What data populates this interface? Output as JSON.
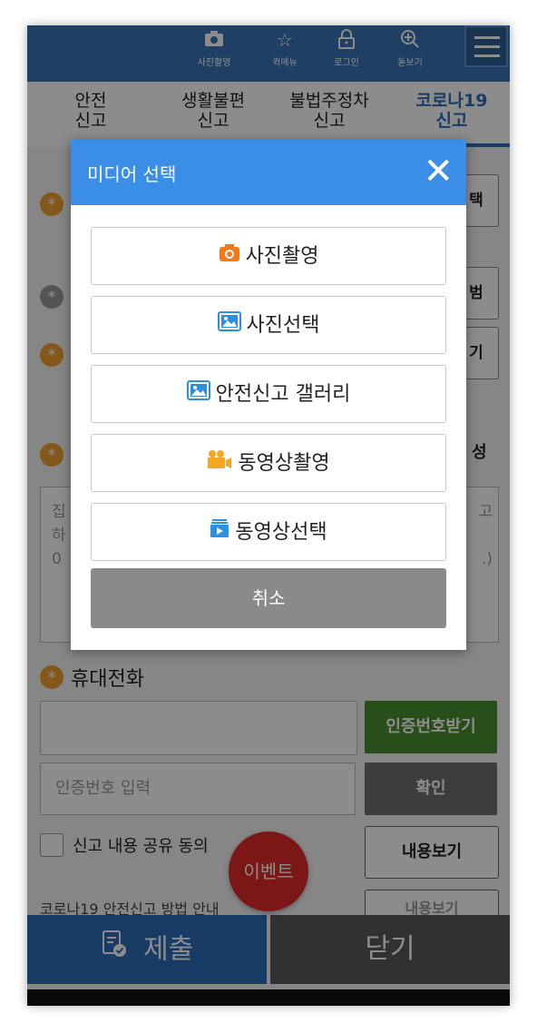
{
  "topbar": {
    "items": [
      {
        "label": "사진촬영",
        "icon": "camera-icon"
      },
      {
        "label": "퀵메뉴",
        "icon": "star-icon"
      },
      {
        "label": "로그인",
        "icon": "lock-icon"
      },
      {
        "label": "돋보기",
        "icon": "zoom-icon"
      }
    ],
    "menu_icon": "hamburger-icon"
  },
  "tabs": [
    {
      "line1": "안전",
      "line2": "신고"
    },
    {
      "line1": "생활불편",
      "line2": "신고"
    },
    {
      "line1": "불법주정차",
      "line2": "신고"
    },
    {
      "line1": "코로나19",
      "line2": "신고"
    }
  ],
  "form": {
    "side_buttons": [
      "택",
      "범",
      "기"
    ],
    "label_suffix": "성",
    "textbox_lines": [
      "집",
      "하",
      "0"
    ],
    "textbox_right": [
      "고",
      ".)"
    ],
    "phone_label": "휴대전화",
    "auth_input_placeholder": "인증번호 입력",
    "request_auth_button": "인증번호받기",
    "confirm_button": "확인",
    "share_consent": "신고 내용 공유 동의",
    "view_content_button": "내용보기",
    "cut_text": "코로나19 안전신고 방법 안내",
    "cut_button": "내용보기"
  },
  "event_button": "이벤트",
  "bottom": {
    "submit": "제출",
    "close": "닫기"
  },
  "modal": {
    "title": "미디어 선택",
    "options": [
      {
        "label": "사진촬영",
        "icon": "camera-icon"
      },
      {
        "label": "사진선택",
        "icon": "image-icon"
      },
      {
        "label": "안전신고 갤러리",
        "icon": "image-icon"
      },
      {
        "label": "동영상촬영",
        "icon": "video-camera-icon"
      },
      {
        "label": "동영상선택",
        "icon": "video-file-icon"
      }
    ],
    "cancel": "취소"
  },
  "colors": {
    "accent": "#3a74b8",
    "modal_header": "#3a8ee6",
    "orange": "#f0a030",
    "green": "#4a8f2e",
    "event": "#e02b2b"
  }
}
